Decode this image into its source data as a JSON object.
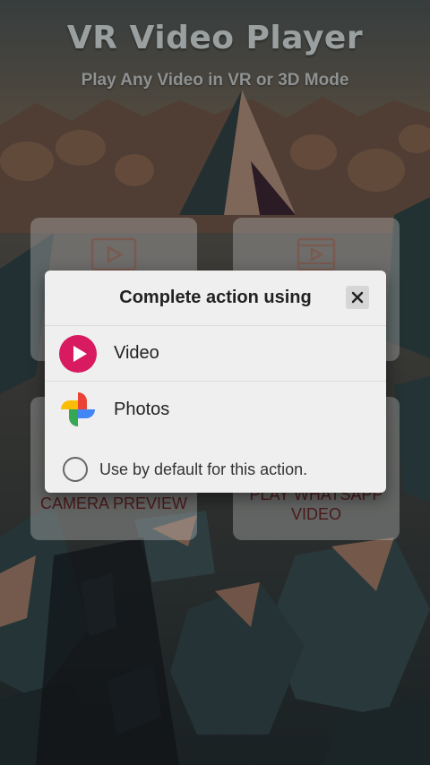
{
  "app": {
    "title": "VR Video Player",
    "subtitle": "Play Any Video in VR or 3D Mode"
  },
  "tiles": [
    {
      "label": "",
      "icon": "play-video-icon"
    },
    {
      "label": "",
      "icon": "film-play-icon"
    },
    {
      "label": "CAMERA PREVIEW",
      "icon": "camera-icon"
    },
    {
      "label": "PLAY WHATSAPP VIDEO",
      "icon": "whatsapp-video-icon"
    }
  ],
  "dialog": {
    "title": "Complete action using",
    "options": [
      {
        "name": "Video",
        "icon": "video-app-icon",
        "color": "#d81b60"
      },
      {
        "name": "Photos",
        "icon": "google-photos-icon"
      }
    ],
    "default_label": "Use by default for this action.",
    "default_checked": false
  },
  "colors": {
    "dialog_bg": "#efefef",
    "video_icon": "#d81b60",
    "tile_label": "#4a1a1a"
  }
}
